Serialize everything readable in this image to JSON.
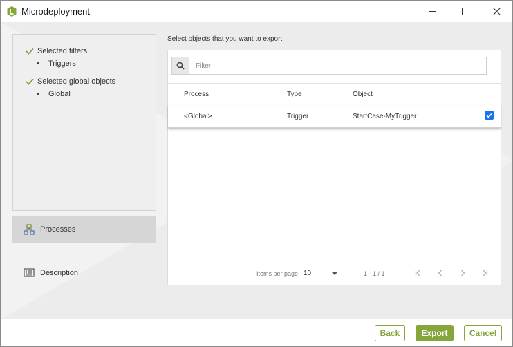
{
  "window": {
    "title": "Microdeployment"
  },
  "summary": {
    "items": [
      {
        "label": "Selected filters",
        "sub": "Triggers"
      },
      {
        "label": "Selected global objects",
        "sub": "Global"
      }
    ]
  },
  "nav": {
    "processes": "Processes",
    "description": "Description"
  },
  "main": {
    "heading": "Select objects that you want to export",
    "filter_placeholder": "Filter",
    "columns": [
      "Process",
      "Type",
      "Object"
    ],
    "rows": [
      {
        "process": "<Global>",
        "type": "Trigger",
        "object": "StartCase-MyTrigger",
        "checked": true
      }
    ],
    "pagination": {
      "items_per_page_label": "Items per page",
      "items_per_page": "10",
      "range": "1 - 1 / 1"
    }
  },
  "buttons": {
    "back": "Back",
    "export": "Export",
    "cancel": "Cancel"
  },
  "colors": {
    "accent": "#86a53d",
    "checkbox": "#1a73e8"
  }
}
